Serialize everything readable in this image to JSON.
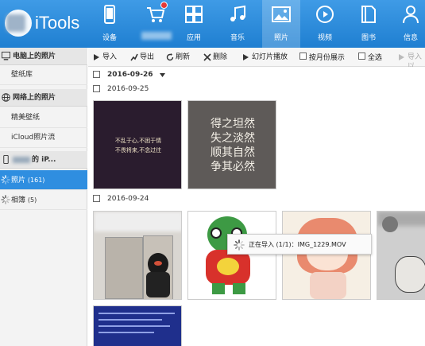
{
  "app": {
    "name": "iTools"
  },
  "nav": [
    {
      "label": "设备",
      "icon": "phone-icon"
    },
    {
      "label": "",
      "icon": "cart-icon",
      "badge": true
    },
    {
      "label": "应用",
      "icon": "apps-icon"
    },
    {
      "label": "音乐",
      "icon": "music-icon"
    },
    {
      "label": "照片",
      "icon": "photo-icon",
      "active": true
    },
    {
      "label": "视频",
      "icon": "video-icon"
    },
    {
      "label": "图书",
      "icon": "book-icon"
    },
    {
      "label": "信息",
      "icon": "user-icon"
    }
  ],
  "sidebar": {
    "pc_section": "电脑上的照片",
    "wallpaper_lib": "壁纸库",
    "net_section": "网络上的照片",
    "fine_wallpaper": "精美壁纸",
    "icloud_stream": "iCloud照片流",
    "device_suffix": "的 iP...",
    "photos_label": "照片",
    "photos_count": "(161)",
    "albums_label": "相簿",
    "albums_count": "(5)"
  },
  "toolbar": {
    "import": "导入",
    "export": "导出",
    "refresh": "刷新",
    "delete": "删除",
    "slideshow": "幻灯片播放",
    "by_month": "按月份展示",
    "select_all": "全选",
    "import_device": "导入以"
  },
  "content": {
    "filter_date": "2016-09-26",
    "group1_date": "2016-09-25",
    "group2_date": "2016-09-24",
    "thumb1_text_line1": "不乱于心,不困于情",
    "thumb1_text_line2": "不畏将来,不念过往",
    "thumb2_text": [
      "得之坦然",
      "失之淡然",
      "顺其自然",
      "争其必然"
    ]
  },
  "toast": {
    "text": "正在导入 (1/1)：IMG_1229.MOV"
  },
  "colors": {
    "accent": "#2f8ee0",
    "topbar": "#2a8ad9"
  }
}
